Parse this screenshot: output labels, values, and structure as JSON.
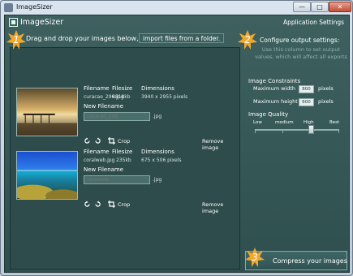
{
  "window": {
    "title": "ImageSizer",
    "minimize_label": "—",
    "maximize_label": "□",
    "close_label": "✕"
  },
  "app": {
    "title": "ImageSizer",
    "settings_label": "Application Settings"
  },
  "steps": [
    "1",
    "2",
    "3"
  ],
  "drop_zone": {
    "text": "Drag and drop your images below, or",
    "import_label": "import files from a folder."
  },
  "columns": {
    "filename": "Filename",
    "filesize": "Filesize",
    "dimensions": "Dimensions",
    "new_filename": "New Filename"
  },
  "images": [
    {
      "filename": "curacao_296.jpg",
      "filesize": "8818kb",
      "dimensions": "3940 x 2955 pixels",
      "new_filename_placeholder": "curacao_296",
      "extension": ".jpg",
      "crop_label": "Crop",
      "remove_label": "Remove image"
    },
    {
      "filename": "coralweb.jpg",
      "filesize": "235kb",
      "dimensions": "675 x 506 pixels",
      "new_filename_placeholder": "coralweb",
      "extension": ".jpg",
      "crop_label": "Crop",
      "remove_label": "Remove image"
    }
  ],
  "output": {
    "heading": "Configure output settings:",
    "hint_line1": "Use this column to set output",
    "hint_line2": "values, which will affect all exports",
    "constraints_label": "Image Constraints",
    "max_width_label": "Maximum width",
    "max_width_value": "800",
    "max_height_label": "Maximum height",
    "max_height_value": "600",
    "unit": "pixels",
    "quality_label": "Image Quality",
    "quality_options": [
      "Low",
      "medium",
      "High",
      "Best"
    ],
    "quality_selected": "High"
  },
  "compress": {
    "label": "Compress your images"
  },
  "colors": {
    "panel": "#2d4c4b",
    "background": "#3e6160",
    "star": "#f2a72a"
  }
}
